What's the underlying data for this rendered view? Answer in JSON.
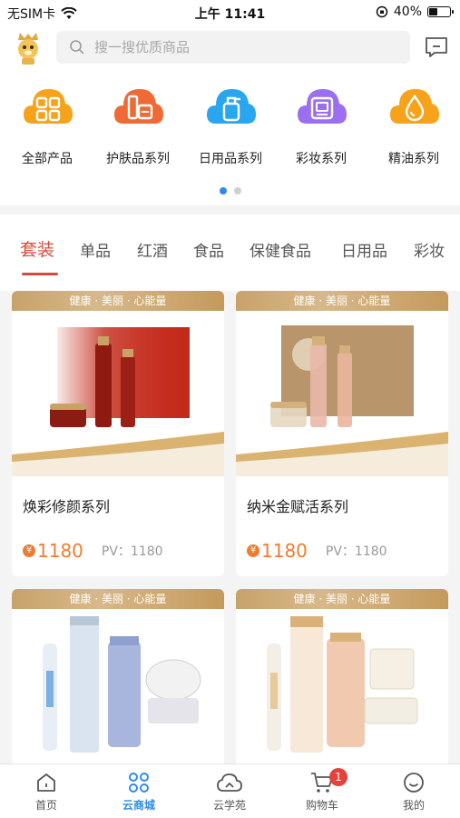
{
  "status_bar": {
    "carrier": "无SIM卡",
    "time": "上午 11:41",
    "battery": "40%",
    "battery_level": 0.4
  },
  "search": {
    "placeholder": "搜一搜优质商品"
  },
  "categories": [
    {
      "label": "全部产品",
      "icon": "grid-icon",
      "color": "#f7a21b"
    },
    {
      "label": "护肤品系列",
      "icon": "skincare-icon",
      "color": "#f06a35"
    },
    {
      "label": "日用品系列",
      "icon": "bottle-icon",
      "color": "#2aa6f0"
    },
    {
      "label": "彩妆系列",
      "icon": "makeup-box-icon",
      "color": "#9b6ff0"
    },
    {
      "label": "精油系列",
      "icon": "drop-icon",
      "color": "#f7a21b"
    }
  ],
  "tabs": [
    "套装",
    "单品",
    "红酒",
    "食品",
    "保健食品",
    "日用品",
    "彩妆"
  ],
  "active_tab": "套装",
  "banner_text": "健康 · 美丽 · 心能量",
  "products": [
    {
      "name": "焕彩修颜系列",
      "price": "1180",
      "pv": "PV：1180"
    },
    {
      "name": "纳米金赋活系列",
      "price": "1180",
      "pv": "PV：1180"
    },
    {
      "banner": "健康 · 美丽 · 心能量"
    },
    {
      "banner": "健康 · 美丽 · 心能量"
    }
  ],
  "nav": [
    {
      "label": "首页",
      "icon": "home-icon"
    },
    {
      "label": "云商城",
      "icon": "mall-icon"
    },
    {
      "label": "云学苑",
      "icon": "cloud-icon"
    },
    {
      "label": "购物车",
      "icon": "cart-icon",
      "badge": "1"
    },
    {
      "label": "我的",
      "icon": "profile-icon"
    }
  ],
  "colors": {
    "accent": "#d94a3e",
    "nav_active": "#2f8be6",
    "price": "#ef7d2e",
    "badge": "#e8403a"
  }
}
